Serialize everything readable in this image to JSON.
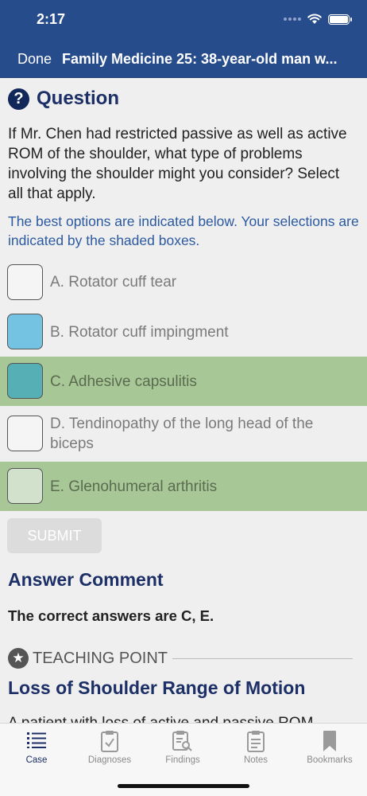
{
  "status": {
    "time": "2:17"
  },
  "nav": {
    "done_label": "Done",
    "title": "Family Medicine 25: 38-year-old man w..."
  },
  "question": {
    "heading": "Question",
    "icon": "question-circle-icon",
    "text": "If Mr. Chen had restricted passive as well as active ROM of the shoulder, what type of problems involving the shoulder might you consider? Select all that apply.",
    "hint": "The best options are indicated below. Your selections are indicated by the shaded boxes."
  },
  "options": [
    {
      "label": "A. Rotator cuff tear",
      "selected": false,
      "correct": false,
      "box_color": "#f5f5f5"
    },
    {
      "label": "B. Rotator cuff impingment",
      "selected": true,
      "correct": false,
      "box_color": "#75c3e3"
    },
    {
      "label": "C. Adhesive capsulitis",
      "selected": true,
      "correct": true,
      "box_color": "#55afb4"
    },
    {
      "label": "D. Tendinopathy of the long head of the biceps",
      "selected": false,
      "correct": false,
      "box_color": "#f5f5f5"
    },
    {
      "label": "E. Glenohumeral arthritis",
      "selected": false,
      "correct": true,
      "box_color": "#d2e1cb"
    }
  ],
  "submit_label": "SUBMIT",
  "answer_comment": {
    "title": "Answer Comment",
    "text": "The correct answers are C, E."
  },
  "teaching_point": {
    "label": "TEACHING POINT",
    "title": "Loss of Shoulder Range of Motion",
    "body": "A patient with loss of active and passive ROM"
  },
  "tabs": [
    {
      "label": "Case",
      "icon": "list-icon",
      "active": true
    },
    {
      "label": "Diagnoses",
      "icon": "clipboard-check-icon",
      "active": false
    },
    {
      "label": "Findings",
      "icon": "clipboard-search-icon",
      "active": false
    },
    {
      "label": "Notes",
      "icon": "clipboard-notes-icon",
      "active": false
    },
    {
      "label": "Bookmarks",
      "icon": "bookmark-icon",
      "active": false
    }
  ],
  "colors": {
    "header_bg": "#264c8c",
    "title_navy": "#1c2f66",
    "hint_blue": "#2c5aa0",
    "correct_bg": "#a8c797"
  }
}
